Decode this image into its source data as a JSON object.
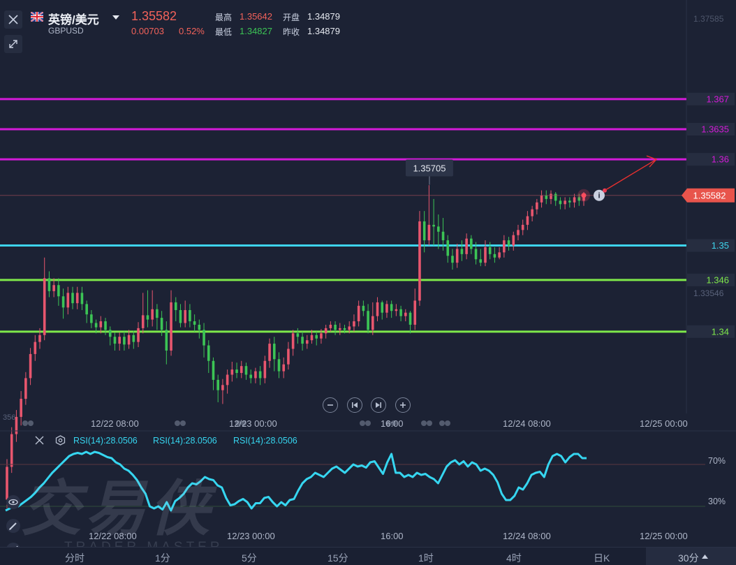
{
  "header": {
    "name": "英镑/美元",
    "code": "GBPUSD",
    "price": "1.35582",
    "change": "0.00703",
    "change_pct": "0.52%",
    "high_label": "最高",
    "high": "1.35642",
    "low_label": "最低",
    "low": "1.34827",
    "open_label": "开盘",
    "open": "1.34879",
    "prev_label": "昨收",
    "prev": "1.34879"
  },
  "colors": {
    "up": "#e8566e",
    "down": "#3cc455",
    "magenta": "#d31ad8",
    "cyan": "#3ed4ec",
    "green_line": "#7ee84a",
    "rsi": "#36d6f0",
    "price_tag": "#e8544c"
  },
  "price_axis": {
    "top_label": "1.37585",
    "bottom_label": "1.33546",
    "current_label": "1.35582",
    "peak_label": "1.35705",
    "cut_label": "356"
  },
  "time_axis": [
    "12/22 08:00",
    "12/23 00:00",
    "16:00",
    "12/24 08:00",
    "12/25 00:00"
  ],
  "rsi_panel": {
    "labels": [
      "RSI(14):28.0506",
      "RSI(14):28.0506",
      "RSI(14):28.0506"
    ],
    "level_high": "70%",
    "level_low": "30%",
    "time_axis": [
      "12/22 08:00",
      "12/23 00:00",
      "16:00",
      "12/24 08:00",
      "12/25 00:00"
    ]
  },
  "watermark": {
    "main": "交易侠",
    "sub": "TRADER MASTER"
  },
  "timeframes": [
    "分时",
    "1分",
    "5分",
    "15分",
    "1时",
    "4时",
    "日K"
  ],
  "timeframe_selected": "30分",
  "chart_data": [
    {
      "type": "candlestick",
      "symbol": "GBPUSD",
      "ylim": [
        1.3305,
        1.3785
      ],
      "x_ticks": [
        "12/22 08:00",
        "12/23 00:00",
        "16:00",
        "12/24 08:00",
        "12/25 00:00"
      ],
      "y_ticks": [
        "1.37585",
        "1.33546"
      ],
      "last_price": 1.35582,
      "high_marker": 1.35705,
      "horizontal_levels": [
        {
          "value": 1.367,
          "label": "1.367",
          "color": "#d31ad8"
        },
        {
          "value": 1.3635,
          "label": "1.3635",
          "color": "#d31ad8"
        },
        {
          "value": 1.36,
          "label": "1.36",
          "color": "#d31ad8"
        },
        {
          "value": 1.35,
          "label": "1.35",
          "color": "#3ed4ec"
        },
        {
          "value": 1.346,
          "label": "1.346",
          "color": "#7ee84a"
        },
        {
          "value": 1.34,
          "label": "1.34",
          "color": "#7ee84a"
        }
      ],
      "candles": [
        [
          1.3205,
          1.3243,
          1.3195,
          1.3252
        ],
        [
          1.3243,
          1.3281,
          1.3236,
          1.3289
        ],
        [
          1.3281,
          1.3301,
          1.3272,
          1.3309
        ],
        [
          1.3301,
          1.3322,
          1.3291,
          1.3331
        ],
        [
          1.3322,
          1.3346,
          1.3315,
          1.3353
        ],
        [
          1.3346,
          1.3374,
          1.3338,
          1.3381
        ],
        [
          1.3374,
          1.3388,
          1.3366,
          1.3396
        ],
        [
          1.3388,
          1.3396,
          1.338,
          1.3404
        ],
        [
          1.3396,
          1.3462,
          1.339,
          1.3486
        ],
        [
          1.3462,
          1.3447,
          1.344,
          1.347
        ],
        [
          1.3447,
          1.3454,
          1.344,
          1.3462
        ],
        [
          1.3454,
          1.3441,
          1.343,
          1.3462
        ],
        [
          1.3441,
          1.3428,
          1.3415,
          1.345
        ],
        [
          1.3428,
          1.3445,
          1.342,
          1.3452
        ],
        [
          1.3445,
          1.3433,
          1.3426,
          1.3452
        ],
        [
          1.3433,
          1.3445,
          1.3426,
          1.3452
        ],
        [
          1.3445,
          1.3432,
          1.3425,
          1.3452
        ],
        [
          1.3432,
          1.342,
          1.341,
          1.3436
        ],
        [
          1.342,
          1.341,
          1.3404,
          1.3425
        ],
        [
          1.341,
          1.3405,
          1.3398,
          1.3414
        ],
        [
          1.3405,
          1.3412,
          1.3398,
          1.3418
        ],
        [
          1.3412,
          1.3402,
          1.3396,
          1.3416
        ],
        [
          1.3402,
          1.3394,
          1.3384,
          1.3406
        ],
        [
          1.3394,
          1.3386,
          1.3378,
          1.3399
        ],
        [
          1.3386,
          1.3394,
          1.3378,
          1.3399
        ],
        [
          1.3394,
          1.3385,
          1.3378,
          1.34
        ],
        [
          1.3385,
          1.3396,
          1.338,
          1.3402
        ],
        [
          1.3396,
          1.3388,
          1.338,
          1.3401
        ],
        [
          1.3388,
          1.3404,
          1.3382,
          1.3411
        ],
        [
          1.3404,
          1.3419,
          1.3398,
          1.3445
        ],
        [
          1.3419,
          1.3414,
          1.3405,
          1.3448
        ],
        [
          1.3414,
          1.3426,
          1.3406,
          1.3448
        ],
        [
          1.3426,
          1.3416,
          1.3402,
          1.3432
        ],
        [
          1.3416,
          1.3402,
          1.3395,
          1.3424
        ],
        [
          1.3402,
          1.3378,
          1.3362,
          1.3412
        ],
        [
          1.3378,
          1.3434,
          1.3372,
          1.3448
        ],
        [
          1.3434,
          1.3425,
          1.3412,
          1.344
        ],
        [
          1.3425,
          1.341,
          1.3405,
          1.3432
        ],
        [
          1.341,
          1.3425,
          1.3405,
          1.3436
        ],
        [
          1.3425,
          1.3412,
          1.3405,
          1.3432
        ],
        [
          1.3412,
          1.3408,
          1.34,
          1.342
        ],
        [
          1.3408,
          1.3402,
          1.3392,
          1.3414
        ],
        [
          1.3402,
          1.3384,
          1.337,
          1.341
        ],
        [
          1.3384,
          1.3366,
          1.3352,
          1.339
        ],
        [
          1.3366,
          1.3344,
          1.3332,
          1.337
        ],
        [
          1.3344,
          1.3332,
          1.3318,
          1.335
        ],
        [
          1.3332,
          1.3338,
          1.3316,
          1.3345
        ],
        [
          1.3338,
          1.335,
          1.3328,
          1.3356
        ],
        [
          1.335,
          1.3356,
          1.3342,
          1.3365
        ],
        [
          1.3356,
          1.3352,
          1.3346,
          1.3364
        ],
        [
          1.3352,
          1.336,
          1.3346,
          1.3366
        ],
        [
          1.336,
          1.335,
          1.3344,
          1.3364
        ],
        [
          1.335,
          1.3346,
          1.334,
          1.3356
        ],
        [
          1.3346,
          1.3354,
          1.334,
          1.3358
        ],
        [
          1.3354,
          1.3346,
          1.3338,
          1.336
        ],
        [
          1.3346,
          1.3366,
          1.334,
          1.3372
        ],
        [
          1.3366,
          1.3386,
          1.3358,
          1.3392
        ],
        [
          1.3386,
          1.3368,
          1.3354,
          1.3394
        ],
        [
          1.3368,
          1.3354,
          1.3346,
          1.3376
        ],
        [
          1.3354,
          1.3362,
          1.3346,
          1.337
        ],
        [
          1.3362,
          1.338,
          1.3356,
          1.3388
        ],
        [
          1.338,
          1.3398,
          1.3372,
          1.3402
        ],
        [
          1.3398,
          1.3394,
          1.3386,
          1.3404
        ],
        [
          1.3394,
          1.3386,
          1.3378,
          1.34
        ],
        [
          1.3386,
          1.339,
          1.338,
          1.3396
        ],
        [
          1.339,
          1.3396,
          1.3386,
          1.3402
        ],
        [
          1.3396,
          1.3392,
          1.3384,
          1.34
        ],
        [
          1.3392,
          1.3398,
          1.3386,
          1.3403
        ],
        [
          1.3398,
          1.3404,
          1.3392,
          1.3408
        ],
        [
          1.3404,
          1.3408,
          1.34,
          1.3412
        ],
        [
          1.3408,
          1.3402,
          1.3396,
          1.3412
        ],
        [
          1.3402,
          1.3404,
          1.3396,
          1.341
        ],
        [
          1.3404,
          1.3402,
          1.3398,
          1.3408
        ],
        [
          1.3402,
          1.3406,
          1.3398,
          1.3412
        ],
        [
          1.3406,
          1.3412,
          1.34,
          1.342
        ],
        [
          1.3412,
          1.343,
          1.3406,
          1.3436
        ],
        [
          1.343,
          1.3424,
          1.3418,
          1.3436
        ],
        [
          1.3424,
          1.3402,
          1.3398,
          1.3432
        ],
        [
          1.3402,
          1.3418,
          1.3396,
          1.3434
        ],
        [
          1.3418,
          1.3434,
          1.3412,
          1.344
        ],
        [
          1.3434,
          1.3422,
          1.3414,
          1.3436
        ],
        [
          1.3422,
          1.3432,
          1.3416,
          1.3436
        ],
        [
          1.3432,
          1.3424,
          1.3416,
          1.3436
        ],
        [
          1.3424,
          1.3426,
          1.3418,
          1.3432
        ],
        [
          1.3426,
          1.3418,
          1.3412,
          1.343
        ],
        [
          1.3418,
          1.3422,
          1.3412,
          1.3426
        ],
        [
          1.3422,
          1.3408,
          1.3398,
          1.3424
        ],
        [
          1.3408,
          1.3436,
          1.3402,
          1.345
        ],
        [
          1.3436,
          1.3528,
          1.343,
          1.354
        ],
        [
          1.3528,
          1.3506,
          1.3492,
          1.354
        ],
        [
          1.3506,
          1.3524,
          1.35,
          1.357
        ],
        [
          1.3524,
          1.3522,
          1.35,
          1.3554
        ],
        [
          1.3522,
          1.3516,
          1.3496,
          1.3536
        ],
        [
          1.3516,
          1.3506,
          1.3494,
          1.3532
        ],
        [
          1.3506,
          1.3488,
          1.348,
          1.3512
        ],
        [
          1.3488,
          1.348,
          1.3472,
          1.3496
        ],
        [
          1.348,
          1.3496,
          1.3474,
          1.3502
        ],
        [
          1.3496,
          1.349,
          1.3482,
          1.3506
        ],
        [
          1.349,
          1.3508,
          1.3484,
          1.3514
        ],
        [
          1.3508,
          1.3496,
          1.349,
          1.3512
        ],
        [
          1.3496,
          1.3484,
          1.3478,
          1.3504
        ],
        [
          1.3484,
          1.348,
          1.3476,
          1.3496
        ],
        [
          1.348,
          1.3498,
          1.3476,
          1.3506
        ],
        [
          1.3498,
          1.349,
          1.3484,
          1.3504
        ],
        [
          1.349,
          1.3486,
          1.348,
          1.3498
        ],
        [
          1.3486,
          1.3492,
          1.3484,
          1.3498
        ],
        [
          1.3492,
          1.3506,
          1.3486,
          1.3512
        ],
        [
          1.3506,
          1.35,
          1.3494,
          1.351
        ],
        [
          1.35,
          1.3512,
          1.3494,
          1.3516
        ],
        [
          1.3512,
          1.3518,
          1.3506,
          1.3524
        ],
        [
          1.3518,
          1.3524,
          1.3512,
          1.353
        ],
        [
          1.3524,
          1.3534,
          1.3518,
          1.354
        ],
        [
          1.3534,
          1.3542,
          1.3528,
          1.3546
        ],
        [
          1.3542,
          1.355,
          1.3536,
          1.3554
        ],
        [
          1.355,
          1.3558,
          1.3544,
          1.3564
        ],
        [
          1.3558,
          1.3554,
          1.3548,
          1.3564
        ],
        [
          1.3554,
          1.356,
          1.3548,
          1.3564
        ],
        [
          1.356,
          1.3552,
          1.3546,
          1.3562
        ],
        [
          1.3552,
          1.3548,
          1.3542,
          1.3556
        ],
        [
          1.3548,
          1.3552,
          1.3542,
          1.3556
        ],
        [
          1.3552,
          1.355,
          1.3544,
          1.3556
        ],
        [
          1.355,
          1.3556,
          1.3544,
          1.356
        ],
        [
          1.3556,
          1.3552,
          1.3546,
          1.356
        ],
        [
          1.3552,
          1.3558,
          1.3546,
          1.3562
        ]
      ]
    },
    {
      "type": "line",
      "name": "RSI(14)",
      "ylim": [
        0,
        100
      ],
      "levels": [
        70,
        30
      ],
      "values": [
        26,
        28,
        31,
        30,
        33,
        36,
        39,
        43,
        48,
        52,
        57,
        62,
        66,
        70,
        74,
        78,
        80,
        81,
        80,
        82,
        80,
        82,
        81,
        79,
        77,
        76,
        72,
        70,
        66,
        64,
        60,
        55,
        48,
        42,
        30,
        28,
        30,
        27,
        34,
        26,
        35,
        38,
        42,
        48,
        52,
        51,
        54,
        58,
        56,
        55,
        50,
        48,
        38,
        31,
        32,
        35,
        37,
        34,
        28,
        33,
        33,
        38,
        39,
        34,
        30,
        34,
        31,
        36,
        37,
        45,
        52,
        56,
        58,
        62,
        60,
        58,
        62,
        66,
        68,
        65,
        62,
        66,
        70,
        68,
        69,
        67,
        72,
        73,
        67,
        61,
        72,
        80,
        62,
        62,
        58,
        60,
        58,
        62,
        60,
        61,
        58,
        56,
        52,
        60,
        68,
        72,
        74,
        70,
        73,
        68,
        72,
        70,
        64,
        66,
        64,
        60,
        53,
        42,
        36,
        36,
        40,
        48,
        46,
        52,
        60,
        62,
        63,
        58,
        70,
        78,
        80,
        78,
        72,
        77,
        80,
        80,
        76,
        76
      ]
    }
  ]
}
